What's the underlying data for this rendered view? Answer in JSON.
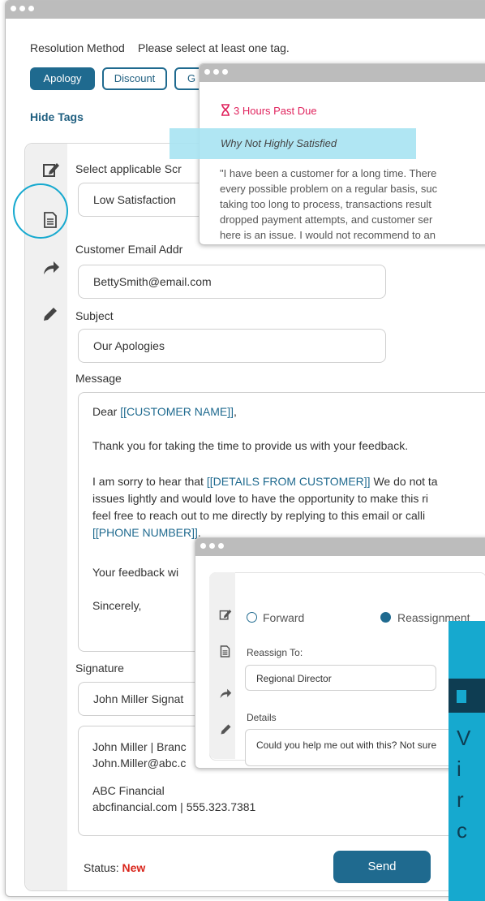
{
  "resolution": {
    "method_label": "Resolution Method",
    "hint": "Please select at least one tag.",
    "tags": [
      "Apology",
      "Discount",
      "G"
    ],
    "hide_tags": "Hide Tags"
  },
  "form": {
    "script_label": "Select applicable Scr",
    "script_value": "Low Satisfaction",
    "email_label": "Customer Email Addr",
    "email_value": "BettySmith@email.com",
    "subject_label": "Subject",
    "subject_value": "Our Apologies",
    "message_label": "Message",
    "message": {
      "greeting_prefix": "Dear ",
      "customer_name": "[[CUSTOMER NAME]]",
      "greeting_suffix": ",",
      "p1": "Thank you for taking the time to provide us with your feedback.",
      "p2_prefix": "I am sorry to hear that  ",
      "details": "[[DETAILS FROM CUSTOMER]]",
      "p2_suffix": " We do not ta",
      "p2_line2": "issues lightly and would love to have the opportunity to make this ri",
      "p2_line3": "feel free to reach out to me directly by replying to this email or calli",
      "phone": "[[PHONE NUMBER]]",
      "phone_suffix": ".",
      "p3": "Your feedback wi",
      "closing": "Sincerely,"
    },
    "signature_label": "Signature",
    "signature_value": "John Miller Signat",
    "sig_line1": "John Miller | Branc",
    "sig_line2": "John.Miller@abc.c",
    "sig_line3": "ABC Financial",
    "sig_line4": "abcfinancial.com | 555.323.7381",
    "status_label": "Status: ",
    "status_value": "New",
    "send_label": "Send"
  },
  "feedback_popup": {
    "due": "3 Hours Past Due",
    "heading": "Why Not Highly Satisfied",
    "lines": [
      "\"I have been a customer for a long time. There",
      "every possible problem on a regular basis, suc",
      "taking too long to process, transactions result",
      "dropped payment attempts, and customer ser",
      "here is an issue. I would not recommend to an"
    ]
  },
  "assign_popup": {
    "forward": "Forward",
    "reassignment": "Reassignment",
    "reassign_label": "Reassign To:",
    "reassign_value": "Regional Director",
    "details_label": "Details",
    "details_value": "Could you help me out with this? Not sure"
  },
  "teal_card": {
    "letters": [
      "V",
      "i",
      "r",
      "c"
    ]
  },
  "colors": {
    "accent": "#1f6a8f",
    "due": "#e0245e",
    "status_new": "#d9261c",
    "highlight": "#a7e3f2",
    "teal": "#16a9cf",
    "teal_dark": "#0e3d52"
  }
}
